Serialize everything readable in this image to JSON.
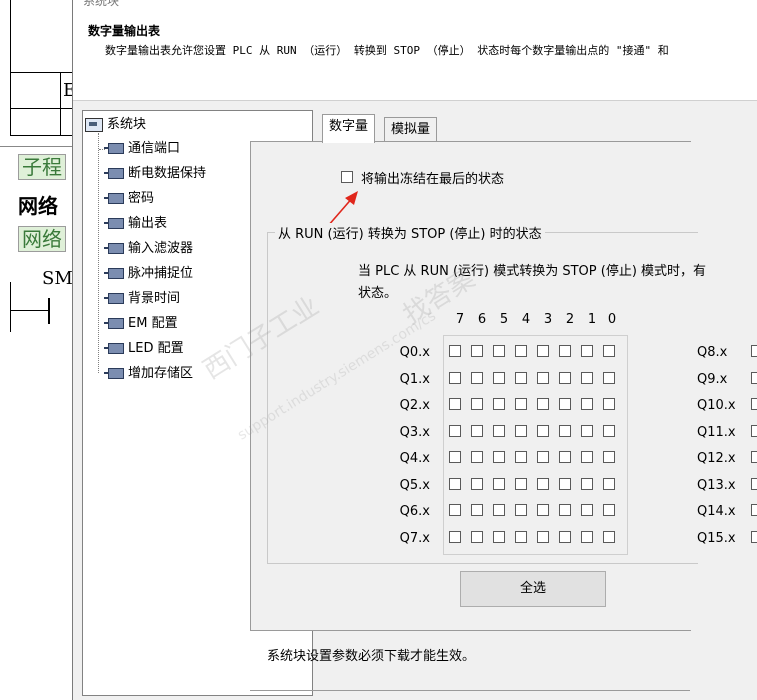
{
  "window_title_fragment": "系统块",
  "header": {
    "title": "数字量输出表",
    "description": "数字量输出表允许您设置 PLC 从 RUN （运行） 转换到 STOP （停止） 状态时每个数字量输出点的 \"接通\" 和"
  },
  "background_editor": {
    "label_subroutine": "子程",
    "label_network_bold": "网络",
    "label_network_green": "网络",
    "label_smo": "SMO",
    "label_partial_e": "E"
  },
  "tree": {
    "root": "系统块",
    "items": [
      "通信端口",
      "断电数据保持",
      "密码",
      "输出表",
      "输入滤波器",
      "脉冲捕捉位",
      "背景时间",
      "EM 配置",
      "LED 配置",
      "增加存储区"
    ]
  },
  "tabs": [
    "数字量",
    "模拟量"
  ],
  "freeze_checkbox": {
    "label": "将输出冻结在最后的状态",
    "checked": false
  },
  "group": {
    "legend": "从 RUN (运行) 转换为 STOP (停止) 时的状态",
    "description_line1": "当 PLC 从 RUN (运行) 模式转换为 STOP (停止) 模式时，有",
    "description_line2": "状态。",
    "bit_headers": [
      "7",
      "6",
      "5",
      "4",
      "3",
      "2",
      "1",
      "0"
    ],
    "rows_left": [
      "Q0.x",
      "Q1.x",
      "Q2.x",
      "Q3.x",
      "Q4.x",
      "Q5.x",
      "Q6.x",
      "Q7.x"
    ],
    "rows_right": [
      "Q8.x",
      "Q9.x",
      "Q10.x",
      "Q11.x",
      "Q12.x",
      "Q13.x",
      "Q14.x",
      "Q15.x"
    ],
    "select_all_label": "全选"
  },
  "footer_note": "系统块设置参数必须下载才能生效。",
  "watermark": {
    "line1": "西门子工业",
    "line2": "support.industry.siemens.com/cs",
    "line3": "找答案"
  },
  "colors": {
    "arrow": "#e0261b",
    "green_label_bg": "#dff0d8"
  }
}
